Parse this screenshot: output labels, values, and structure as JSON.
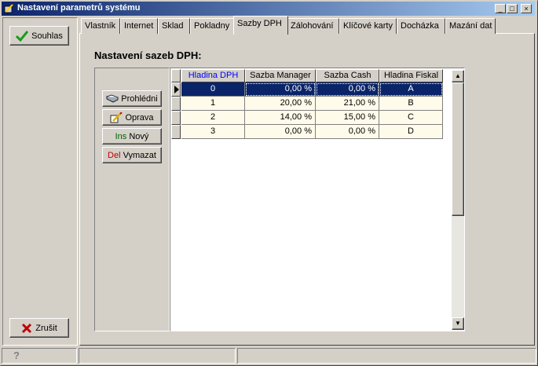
{
  "window": {
    "title": "Nastavení parametrů systému"
  },
  "titlebar": {
    "minimize": "_",
    "maximize": "□",
    "close": "×"
  },
  "sidebar": {
    "ok_label": "Souhlas",
    "cancel_label": "Zrušit"
  },
  "tabs": [
    {
      "label": "Vlastník"
    },
    {
      "label": "Internet"
    },
    {
      "label": "Sklad"
    },
    {
      "label": "Pokladny"
    },
    {
      "label": "Sazby DPH"
    },
    {
      "label": "Zálohování"
    },
    {
      "label": "Klíčové karty"
    },
    {
      "label": "Docházka"
    },
    {
      "label": "Mazání dat"
    }
  ],
  "active_tab": "Sazby DPH",
  "page": {
    "heading": "Nastavení sazeb DPH:"
  },
  "actions": {
    "view": {
      "label": "Prohlédni"
    },
    "edit": {
      "label": "Oprava"
    },
    "new": {
      "key": "Ins",
      "label": "Nový"
    },
    "delete": {
      "key": "Del",
      "label": "Vymazat"
    }
  },
  "table": {
    "columns": [
      "Hladina DPH",
      "Sazba Manager",
      "Sazba Cash",
      "Hladina Fiskal"
    ],
    "rows": [
      [
        "0",
        "0,00 %",
        "0,00 %",
        "A"
      ],
      [
        "1",
        "20,00 %",
        "21,00 %",
        "B"
      ],
      [
        "2",
        "14,00 %",
        "15,00 %",
        "C"
      ],
      [
        "3",
        "0,00 %",
        "0,00 %",
        "D"
      ]
    ],
    "selected_row": 0
  },
  "colors": {
    "title_start": "#0a246a",
    "title_end": "#a6caf0",
    "face": "#d4d0c8",
    "selection": "#0a246a",
    "row_alt": "#fffbea",
    "sorted_header": "#0000ff",
    "del_key": "#c00000",
    "ins_key": "#006000"
  }
}
